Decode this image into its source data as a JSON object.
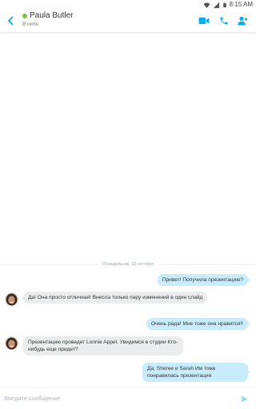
{
  "status_bar": {
    "time": "8:15 AM",
    "icons": [
      "wifi-icon",
      "cellular-signal-icon",
      "battery-icon"
    ]
  },
  "header": {
    "contact_name": "Paula Butler",
    "contact_status": "В сети",
    "presence_color": "#7cc243",
    "icons": [
      "back-arrow-icon",
      "video-call-icon",
      "voice-call-icon",
      "add-person-icon"
    ],
    "accent_color": "#00aff0"
  },
  "conversation": {
    "date_divider": "Понедельник, 23 октября",
    "messages": [
      {
        "direction": "out",
        "text": "Привет! Получила презентацию?"
      },
      {
        "direction": "in",
        "text": "Да! Она просто отличная! Внесла только пару изменений в один слайд"
      },
      {
        "direction": "out",
        "text": "Очень рада! Мне тоже она нравится!!"
      },
      {
        "direction": "in",
        "text": "Презентацию проведет Lonnie Appel. Увидимся в студии Кто-нибудь еще придет?"
      },
      {
        "direction": "out",
        "text": "Да, Sheree и Sarah Им тоже понравилась презентация"
      }
    ]
  },
  "composer": {
    "placeholder": "Введите сообщение",
    "value": "",
    "send_icon": "send-icon"
  }
}
